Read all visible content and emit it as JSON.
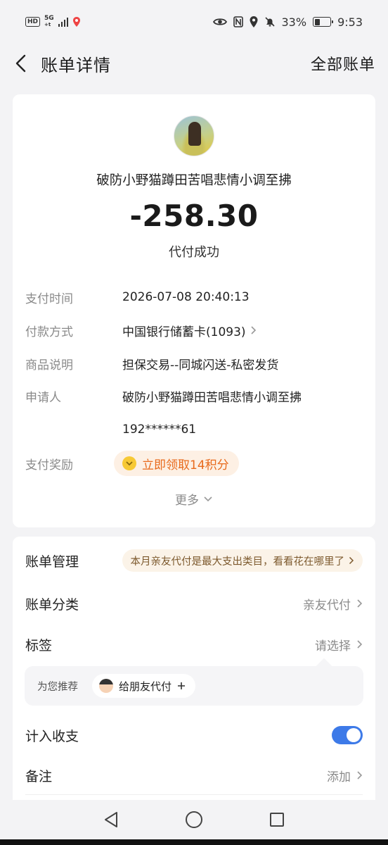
{
  "status_bar": {
    "hd": "HD",
    "network": "5G",
    "network_sub": "+t",
    "battery_percent": "33%",
    "time": "9:53"
  },
  "nav": {
    "title": "账单详情",
    "right_link": "全部账单"
  },
  "bill": {
    "merchant": "破防小野猫蹲田苦唱悲情小调至拂",
    "amount": "-258.30",
    "status": "代付成功",
    "details": [
      {
        "label": "支付时间",
        "value": "2026-07-08 20:40:13"
      },
      {
        "label": "付款方式",
        "value": "中国银行储蓄卡(1093)"
      },
      {
        "label": "商品说明",
        "value": "担保交易--同城闪送-私密发货"
      },
      {
        "label": "申请人",
        "value": "破防小野猫蹲田苦唱悲情小调至拂",
        "value2": "192******61"
      }
    ],
    "reward_label": "支付奖励",
    "reward_action": "立即领取14积分",
    "more": "更多"
  },
  "manage": {
    "bill_manage_label": "账单管理",
    "bill_manage_promo": "本月亲友代付是最大支出类目，看看花在哪里了",
    "category_label": "账单分类",
    "category_value": "亲友代付",
    "tag_label": "标签",
    "tag_value": "请选择",
    "recommend_label": "为您推荐",
    "recommend_chip": "给朋友代付",
    "include_label": "计入收支",
    "include_on": true,
    "note_label": "备注",
    "note_value": "添加"
  },
  "colors": {
    "background": "#f3f3f5",
    "reward_text": "#e86a1c",
    "reward_bg": "#fdf0e4",
    "toggle_on": "#3d7ae8"
  }
}
